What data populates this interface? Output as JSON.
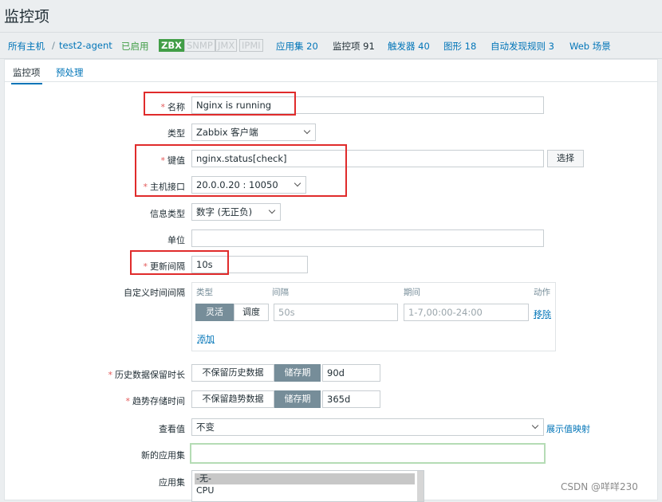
{
  "page": {
    "title": "监控项"
  },
  "breadcrumb": {
    "all_hosts": "所有主机",
    "separator": "/",
    "host": "test2-agent",
    "status": "已启用",
    "zbx": "ZBX",
    "snmp": "SNMP",
    "jmx": "JMX",
    "ipmi": "IPMI",
    "apps": "应用集 20",
    "items": "监控项 91",
    "triggers": "触发器 40",
    "graphs": "图形 18",
    "discovery": "自动发现规则 3",
    "web": "Web 场景"
  },
  "tabs": {
    "item": "监控项",
    "preprocessing": "预处理"
  },
  "form": {
    "required_mark": "*",
    "name_label": "名称",
    "name_value": "Nginx is running",
    "type_label": "类型",
    "type_value": "Zabbix 客户端",
    "key_label": "键值",
    "key_value": "nginx.status[check]",
    "select_button": "选择",
    "interface_label": "主机接口",
    "interface_value": "20.0.0.20 : 10050",
    "info_type_label": "信息类型",
    "info_type_value": "数字 (无正负)",
    "units_label": "单位",
    "units_value": "",
    "interval_label": "更新间隔",
    "interval_value": "10s",
    "custom_intervals_label": "自定义时间间隔",
    "custom": {
      "col_type": "类型",
      "col_interval": "间隔",
      "col_period": "期间",
      "col_action": "动作",
      "flexible": "灵活",
      "scheduling": "调度",
      "interval_placeholder": "50s",
      "period_placeholder": "1-7,00:00-24:00",
      "remove": "移除",
      "add": "添加"
    },
    "history_label": "历史数据保留时长",
    "history_no_keep": "不保留历史数据",
    "history_storage": "储存期",
    "history_value": "90d",
    "trends_label": "趋势存储时间",
    "trends_no_keep": "不保留趋势数据",
    "trends_storage": "储存期",
    "trends_value": "365d",
    "value_map_label": "查看值",
    "value_map_value": "不变",
    "value_map_link": "展示值映射",
    "new_app_label": "新的应用集",
    "new_app_value": "",
    "apps_label": "应用集",
    "apps_options": [
      "-无-",
      "CPU"
    ]
  },
  "watermark": "CSDN @咩咩230"
}
